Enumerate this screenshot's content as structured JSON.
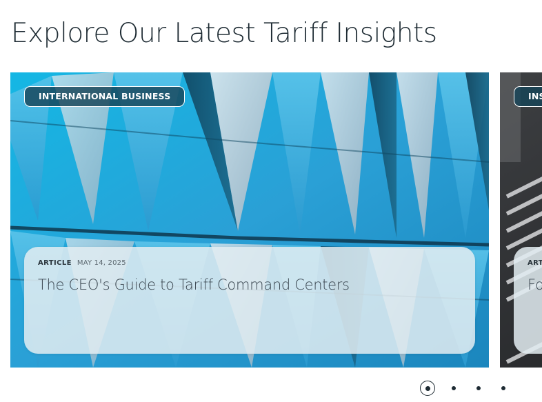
{
  "section": {
    "heading": "Explore Our Latest Tariff Insights"
  },
  "carousel": {
    "cards": [
      {
        "category": "INTERNATIONAL BUSINESS",
        "type": "ARTICLE",
        "date": "MAY 14, 2025",
        "title": "The CEO's Guide to Tariff Command Centers"
      },
      {
        "category": "INS",
        "type": "ART",
        "title": "Fo"
      }
    ],
    "active_index": 0,
    "slide_count": 4
  },
  "colors": {
    "heading_text": "#1e2b33",
    "pill_background": "#174458",
    "glass_panel": "#e2ecf1",
    "sky_blue": "#1fa7d6"
  }
}
